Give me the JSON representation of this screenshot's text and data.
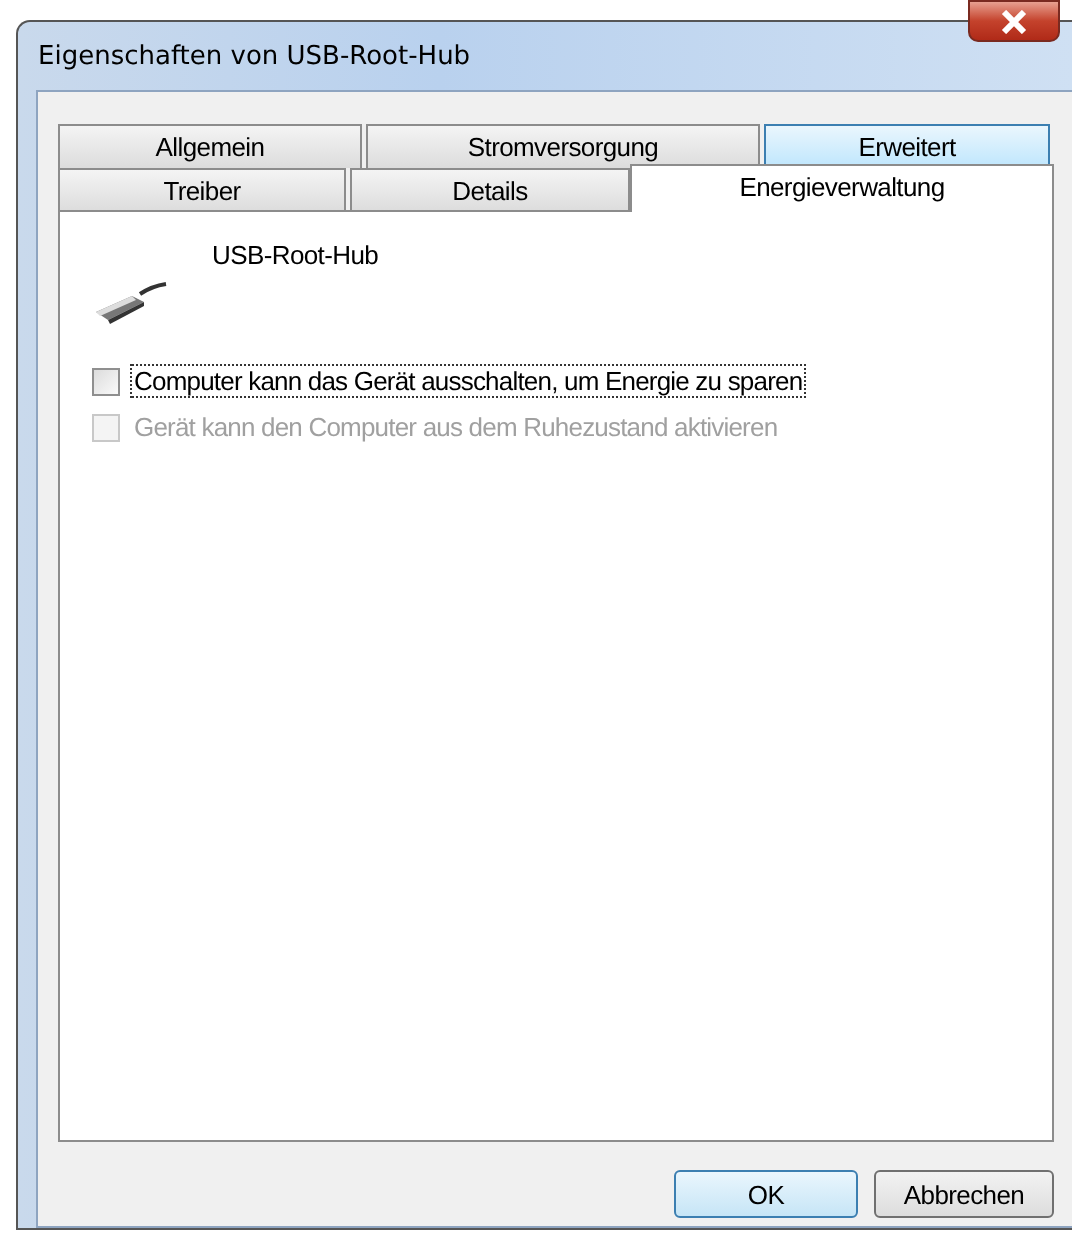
{
  "window": {
    "title": "Eigenschaften von USB-Root-Hub"
  },
  "tab_rows": [
    [
      {
        "label": "Allgemein",
        "selected": false,
        "highlighted": false
      },
      {
        "label": "Stromversorgung",
        "selected": false,
        "highlighted": false
      },
      {
        "label": "Erweitert",
        "selected": false,
        "highlighted": true
      }
    ],
    [
      {
        "label": "Treiber",
        "selected": false,
        "highlighted": false
      },
      {
        "label": "Details",
        "selected": false,
        "highlighted": false
      },
      {
        "label": "Energieverwaltung",
        "selected": true,
        "highlighted": false
      }
    ]
  ],
  "device": {
    "name": "USB-Root-Hub"
  },
  "options": [
    {
      "label": "Computer kann das Gerät ausschalten, um Energie zu sparen",
      "checked": false,
      "disabled": false,
      "focused": true
    },
    {
      "label": "Gerät kann den Computer aus dem Ruhezustand aktivieren",
      "checked": false,
      "disabled": true,
      "focused": false
    }
  ],
  "buttons": [
    {
      "label": "OK",
      "default": true
    },
    {
      "label": "Abbrechen",
      "default": false
    }
  ]
}
